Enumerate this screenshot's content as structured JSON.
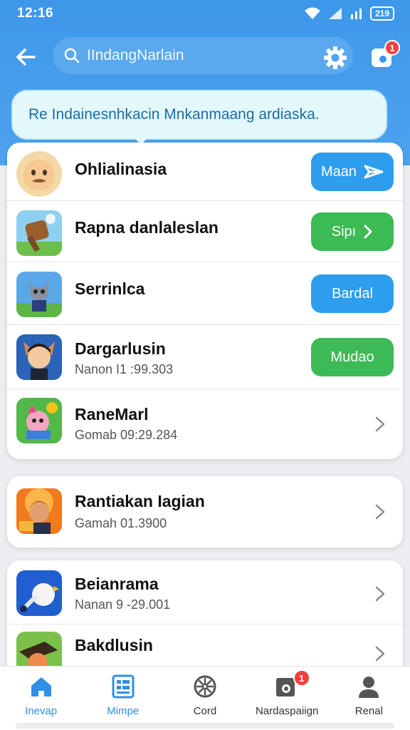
{
  "status_bar": {
    "time": "12:16",
    "battery": "219"
  },
  "header": {
    "search_placeholder": "IIndangNarlain",
    "notification_count": "1"
  },
  "banner": {
    "text": "Re Indainesnhkacin Mnkanmaang ardiaska."
  },
  "list_primary": [
    {
      "title": "Ohlialinasia",
      "subtitle": "",
      "action": "Maan",
      "action_style": "blue",
      "action_icon": "send-icon"
    },
    {
      "title": "Rapna danlaleslan",
      "subtitle": "",
      "action": "Sipı",
      "action_style": "green",
      "action_icon": "chevron-right-icon"
    },
    {
      "title": "Serrinlca",
      "subtitle": "",
      "action": "Bardal",
      "action_style": "blue",
      "action_icon": ""
    },
    {
      "title": "Dargarlusin",
      "subtitle": "Nanon I1 :99.303",
      "action": "Mudao",
      "action_style": "green",
      "action_icon": ""
    },
    {
      "title": "RaneMarl",
      "subtitle": "Gomab 09:29.284",
      "action": "",
      "action_style": "",
      "action_icon": "chevron-right-icon"
    }
  ],
  "list_secondary": [
    {
      "title": "Rantiakan Iagian",
      "subtitle": "Gamah 01.3900"
    }
  ],
  "list_tertiary": [
    {
      "title": "Beianrama",
      "subtitle": "Nanan 9 -29.001"
    },
    {
      "title": "Bakdlusin",
      "subtitle": ""
    }
  ],
  "tabs": [
    {
      "label": "Inevap",
      "icon": "home-icon",
      "active": true
    },
    {
      "label": "Mimpe",
      "icon": "list-icon",
      "active": false
    },
    {
      "label": "Cord",
      "icon": "wheel-icon",
      "active": false
    },
    {
      "label": "Nardaspaiign",
      "icon": "photo-icon",
      "active": false,
      "badge": "1"
    },
    {
      "label": "Renal",
      "icon": "profile-icon",
      "active": false
    }
  ],
  "colors": {
    "primary_blue": "#3d97ea",
    "button_blue": "#2d9ded",
    "button_green": "#3cba55",
    "badge_red": "#f0413e"
  }
}
